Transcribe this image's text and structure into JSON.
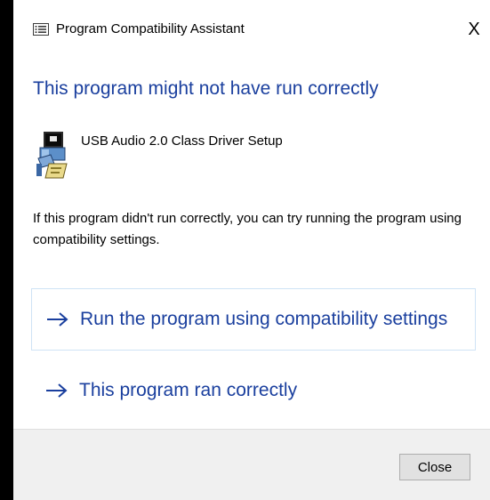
{
  "window": {
    "title": "Program Compatibility Assistant",
    "close_glyph": "X",
    "app_icon": "list-window-icon"
  },
  "main": {
    "heading": "This program might not have run correctly",
    "program": {
      "icon": "installer-setup-icon",
      "name": "USB Audio 2.0 Class Driver Setup"
    },
    "description": "If this program didn't run correctly, you can try running the program using compatibility settings."
  },
  "options": [
    {
      "label": "Run the program using compatibility settings",
      "icon": "arrow-right-icon"
    },
    {
      "label": "This program ran correctly",
      "icon": "arrow-right-icon"
    }
  ],
  "footer": {
    "close_label": "Close"
  },
  "colors": {
    "accent": "#1a3f9e",
    "focus_border": "#cfe3f5",
    "footer_bg": "#f0f0f0",
    "button_bg": "#e1e1e1",
    "backdrop": "#000000"
  }
}
